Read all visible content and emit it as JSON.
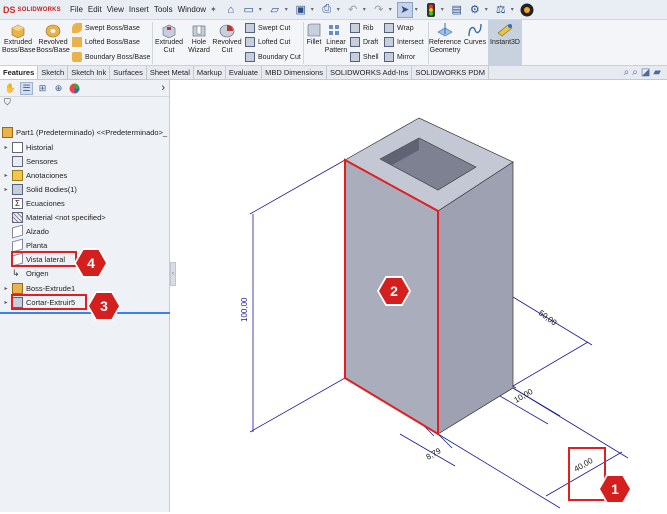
{
  "app": {
    "logo_mark": "DS",
    "logo_text": "SOLIDWORKS"
  },
  "menus": [
    "File",
    "Edit",
    "View",
    "Insert",
    "Tools",
    "Window"
  ],
  "quick_access": [
    "home-icon",
    "new-icon",
    "open-icon",
    "save-icon",
    "print-icon",
    "undo-icon",
    "redo-icon",
    "select-icon",
    "traffic-light-icon",
    "file-properties-icon",
    "options-icon",
    "balance-icon",
    "help-icon"
  ],
  "ribbon": {
    "extruded_boss": "Extruded\nBoss/Base",
    "revolved_boss": "Revolved\nBoss/Base",
    "swept_boss": "Swept Boss/Base",
    "lofted_boss": "Lofted Boss/Base",
    "boundary_boss": "Boundary Boss/Base",
    "extruded_cut": "Extruded\nCut",
    "hole_wizard": "Hole\nWizard",
    "revolved_cut": "Revolved\nCut",
    "swept_cut": "Swept Cut",
    "lofted_cut": "Lofted Cut",
    "boundary_cut": "Boundary Cut",
    "fillet": "Fillet",
    "linear_pattern": "Linear\nPattern",
    "rib": "Rib",
    "draft": "Draft",
    "shell": "Shell",
    "wrap": "Wrap",
    "intersect": "Intersect",
    "mirror": "Mirror",
    "reference_geometry": "Reference\nGeometry",
    "curves": "Curves",
    "instant3d": "Instant3D"
  },
  "tabs": [
    "Features",
    "Sketch",
    "Sketch Ink",
    "Surfaces",
    "Sheet Metal",
    "Markup",
    "Evaluate",
    "MBD Dimensions",
    "SOLIDWORKS Add-Ins",
    "SOLIDWORKS PDM"
  ],
  "active_tab": "Features",
  "tree": {
    "part": "Part1 (Predeterminado) <<Predeterminado>_",
    "items": [
      {
        "label": "Historial",
        "icon": "history-icon",
        "expand": true
      },
      {
        "label": "Sensores",
        "icon": "sensor-icon",
        "expand": false
      },
      {
        "label": "Anotaciones",
        "icon": "annotation-icon",
        "expand": true
      },
      {
        "label": "Solid Bodies(1)",
        "icon": "solid-body-icon",
        "expand": true
      },
      {
        "label": "Ecuaciones",
        "icon": "equation-icon",
        "expand": false
      },
      {
        "label": "Material <not specified>",
        "icon": "material-icon",
        "expand": false
      },
      {
        "label": "Alzado",
        "icon": "plane-icon",
        "expand": false
      },
      {
        "label": "Planta",
        "icon": "plane-icon",
        "expand": false
      },
      {
        "label": "Vista lateral",
        "icon": "plane-icon",
        "expand": false
      },
      {
        "label": "Origen",
        "icon": "origin-icon",
        "expand": false
      },
      {
        "label": "Boss-Extrude1",
        "icon": "extrude-icon",
        "expand": true
      },
      {
        "label": "Cortar-Extruir5",
        "icon": "cut-extrude-icon",
        "expand": true
      }
    ]
  },
  "dimensions": {
    "height": "100,00",
    "depth": "50,00",
    "wall": "10,00",
    "thickness": "8,79",
    "width": "40,00"
  },
  "markers": [
    "1",
    "2",
    "3",
    "4"
  ],
  "colors": {
    "marker": "#d41f1f",
    "highlight": "#e02020",
    "dimension": "#1a1a9a",
    "body": "#a9adbc",
    "selection": "#3b82f0"
  }
}
